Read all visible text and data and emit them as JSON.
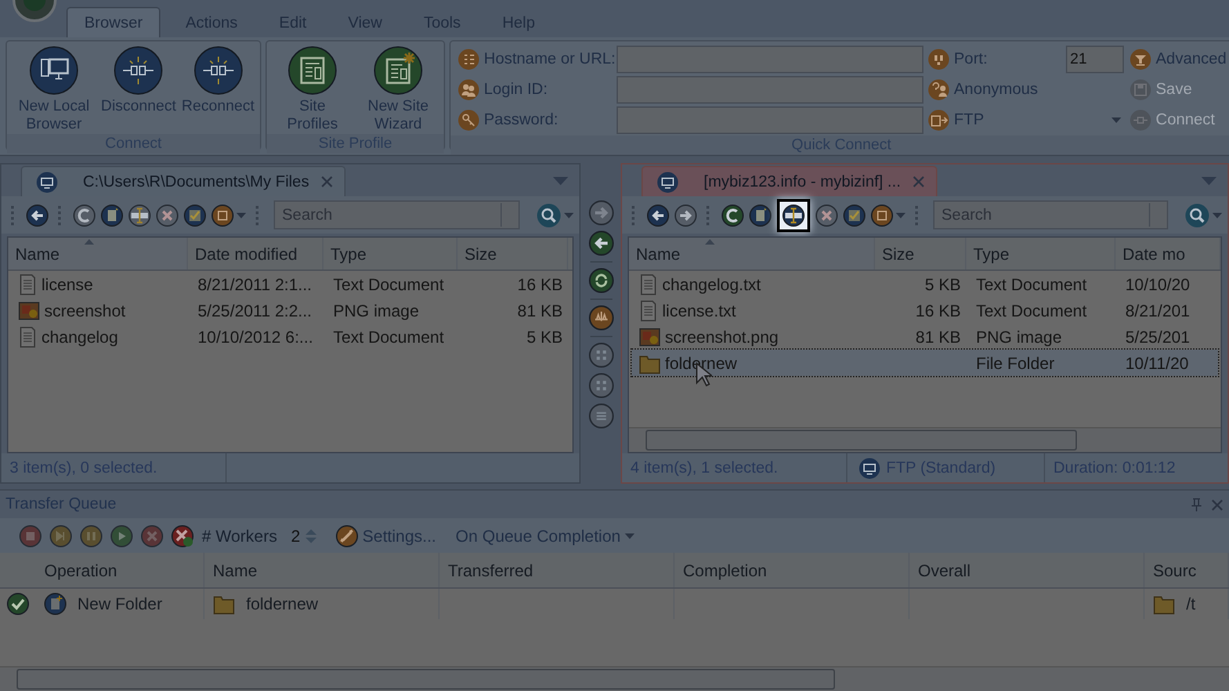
{
  "menu_tabs": [
    {
      "label": "Browser",
      "selected": true
    },
    {
      "label": "Actions",
      "selected": false
    },
    {
      "label": "Edit",
      "selected": false
    },
    {
      "label": "View",
      "selected": false
    },
    {
      "label": "Tools",
      "selected": false
    },
    {
      "label": "Help",
      "selected": false
    }
  ],
  "ribbon": {
    "groups": [
      {
        "title": "Connect",
        "buttons": [
          {
            "label": "New Local Browser",
            "kind": "monitor"
          },
          {
            "label": "Disconnect",
            "kind": "plug"
          },
          {
            "label": "Reconnect",
            "kind": "plug"
          }
        ]
      },
      {
        "title": "Site Profile",
        "buttons": [
          {
            "label": "Site Profiles",
            "kind": "profile"
          },
          {
            "label": "New Site Wizard",
            "kind": "profile-new"
          }
        ]
      }
    ],
    "quick_connect": {
      "title": "Quick Connect",
      "fields": [
        {
          "label": "Hostname or URL:",
          "kind": "list"
        },
        {
          "label": "Login ID:",
          "kind": "users"
        },
        {
          "label": "Password:",
          "kind": "key"
        }
      ],
      "port_label": "Port:",
      "port_value": "21",
      "anonymous": "Anonymous",
      "protocol": "FTP",
      "actions": [
        {
          "label": "Advanced",
          "disabled": false,
          "kind": "advanced"
        },
        {
          "label": "Save",
          "disabled": true,
          "kind": "save"
        },
        {
          "label": "Connect",
          "disabled": true,
          "kind": "plug"
        }
      ]
    }
  },
  "panes": [
    {
      "active": false,
      "tab_title": "C:\\Users\\R\\Documents\\My Files",
      "search_placeholder": "Search",
      "toolbar": [
        {
          "kind": "back",
          "disabled": false,
          "highlighted": false
        },
        {
          "kind": "refresh",
          "disabled": true,
          "highlighted": false
        },
        {
          "kind": "new-folder",
          "disabled": false,
          "highlighted": false
        },
        {
          "kind": "rename",
          "disabled": true,
          "highlighted": false
        },
        {
          "kind": "delete",
          "disabled": true,
          "highlighted": false
        },
        {
          "kind": "properties",
          "disabled": false,
          "highlighted": false
        },
        {
          "kind": "view",
          "disabled": false,
          "highlighted": false
        }
      ],
      "columns": [
        {
          "label": "Name",
          "kind": "name",
          "sorted": true
        },
        {
          "label": "Date modified",
          "kind": "date",
          "sorted": false
        },
        {
          "label": "Type",
          "kind": "type",
          "sorted": false
        },
        {
          "label": "Size",
          "kind": "size",
          "sorted": false
        }
      ],
      "rows": [
        {
          "kind": "text",
          "name": "license",
          "date": "8/21/2011 2:1...",
          "type": "Text Document",
          "size": "16 KB",
          "selected": false
        },
        {
          "kind": "image",
          "name": "screenshot",
          "date": "5/25/2011 2:2...",
          "type": "PNG image",
          "size": "81 KB",
          "selected": false
        },
        {
          "kind": "text",
          "name": "changelog",
          "date": "10/10/2012 6:...",
          "type": "Text Document",
          "size": "5 KB",
          "selected": false
        }
      ],
      "status": [
        "3 item(s), 0 selected."
      ]
    },
    {
      "active": true,
      "tab_title": "[mybiz123.info - mybizinf] ...",
      "search_placeholder": "Search",
      "toolbar": [
        {
          "kind": "back",
          "disabled": false,
          "highlighted": false
        },
        {
          "kind": "forward",
          "disabled": true,
          "highlighted": false
        },
        {
          "kind": "refresh",
          "disabled": false,
          "highlighted": false
        },
        {
          "kind": "new-folder",
          "disabled": false,
          "highlighted": false
        },
        {
          "kind": "rename",
          "disabled": false,
          "highlighted": true
        },
        {
          "kind": "delete",
          "disabled": true,
          "highlighted": false
        },
        {
          "kind": "properties",
          "disabled": false,
          "highlighted": false
        },
        {
          "kind": "view",
          "disabled": false,
          "highlighted": false
        }
      ],
      "columns": [
        {
          "label": "Name",
          "kind": "name",
          "sorted": true
        },
        {
          "label": "Size",
          "kind": "size",
          "sorted": false
        },
        {
          "label": "Type",
          "kind": "type",
          "sorted": false
        },
        {
          "label": "Date mo",
          "kind": "date",
          "sorted": false
        }
      ],
      "rows": [
        {
          "kind": "text",
          "name": "changelog.txt",
          "date": "10/10/20",
          "type": "Text Document",
          "size": "5 KB",
          "selected": false
        },
        {
          "kind": "text",
          "name": "license.txt",
          "date": "8/21/201",
          "type": "Text Document",
          "size": "16 KB",
          "selected": false
        },
        {
          "kind": "image",
          "name": "screenshot.png",
          "date": "5/25/201",
          "type": "PNG image",
          "size": "81 KB",
          "selected": false
        },
        {
          "kind": "folder",
          "name": "foldernew",
          "date": "10/11/20",
          "type": "File Folder",
          "selected": true
        }
      ],
      "status": [
        "4 item(s), 1 selected.",
        "FTP (Standard)",
        "Duration: 0:01:12"
      ]
    }
  ],
  "transfer_buttons": [
    {
      "kind": "upload",
      "disabled": true
    },
    {
      "kind": "download",
      "disabled": false
    },
    {
      "kind": "sync",
      "disabled": false
    },
    {
      "kind": "compare",
      "disabled": false
    },
    {
      "kind": "grid",
      "disabled": true
    },
    {
      "kind": "grid",
      "disabled": true
    },
    {
      "kind": "list",
      "disabled": true
    }
  ],
  "transfer_queue": {
    "title": "Transfer Queue",
    "workers_label": "# Workers",
    "workers_value": "2",
    "settings": "Settings...",
    "completion": "On Queue Completion",
    "columns": [
      "Operation",
      "Name",
      "Transferred",
      "Completion",
      "Overall",
      "Sourc"
    ],
    "rows": [
      {
        "done": true,
        "operation": "New Folder",
        "name": "foldernew",
        "source": "/t"
      }
    ]
  }
}
